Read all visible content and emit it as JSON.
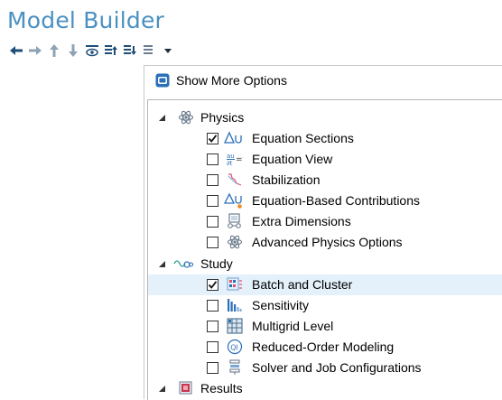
{
  "header": {
    "title": "Model Builder"
  },
  "toolbar": {
    "buttons": [
      {
        "icon": "arrow-left-icon"
      },
      {
        "icon": "arrow-right-icon"
      },
      {
        "icon": "arrow-up-icon"
      },
      {
        "icon": "arrow-down-icon"
      },
      {
        "icon": "show-more-options-icon"
      },
      {
        "icon": "expand-sections-icon"
      },
      {
        "icon": "collapse-sections-icon"
      },
      {
        "icon": "list-options-icon"
      },
      {
        "icon": "dropdown-caret-icon"
      }
    ]
  },
  "dialog": {
    "title": "Show More Options",
    "tree": [
      {
        "label": "Physics",
        "level": 0,
        "expanded": true,
        "icon": "physics-atom-icon"
      },
      {
        "label": "Equation Sections",
        "level": 1,
        "checked": true,
        "icon": "delta-u-icon"
      },
      {
        "label": "Equation View",
        "level": 1,
        "checked": false,
        "icon": "equation-view-icon"
      },
      {
        "label": "Stabilization",
        "level": 1,
        "checked": false,
        "icon": "stabilization-icon"
      },
      {
        "label": "Equation-Based Contributions",
        "level": 1,
        "checked": false,
        "icon": "delta-u-plus-icon"
      },
      {
        "label": "Extra Dimensions",
        "level": 1,
        "checked": false,
        "icon": "extra-dimensions-icon"
      },
      {
        "label": "Advanced Physics Options",
        "level": 1,
        "checked": false,
        "icon": "physics-atom-icon"
      },
      {
        "label": "Study",
        "level": 0,
        "expanded": true,
        "icon": "study-icon"
      },
      {
        "label": "Batch and Cluster",
        "level": 1,
        "checked": true,
        "selected": true,
        "icon": "batch-cluster-icon"
      },
      {
        "label": "Sensitivity",
        "level": 1,
        "checked": false,
        "icon": "sensitivity-icon"
      },
      {
        "label": "Multigrid Level",
        "level": 1,
        "checked": false,
        "icon": "multigrid-icon"
      },
      {
        "label": "Reduced-Order Modeling",
        "level": 1,
        "checked": false,
        "icon": "reduced-order-icon"
      },
      {
        "label": "Solver and Job Configurations",
        "level": 1,
        "checked": false,
        "icon": "solver-config-icon"
      },
      {
        "label": "Results",
        "level": 0,
        "expanded": true,
        "icon": "results-icon"
      }
    ]
  },
  "colors": {
    "title_blue": "#4a90c2",
    "selection": "#e4f1fb",
    "toolbar_icon": "#1f4e79"
  }
}
